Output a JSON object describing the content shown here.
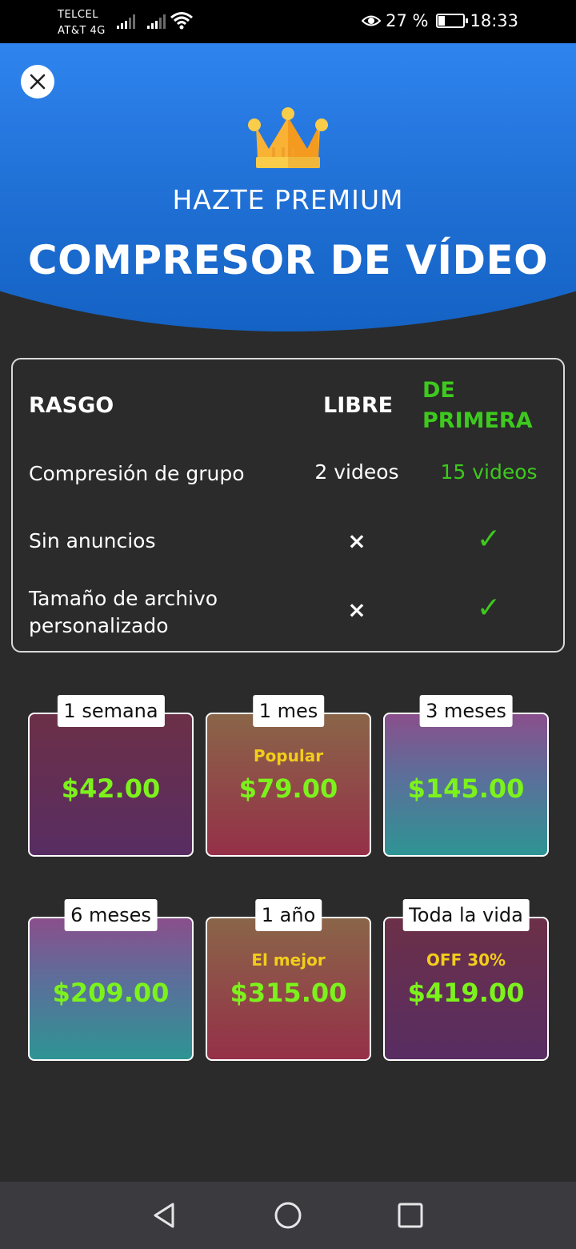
{
  "status_bar": {
    "carrier_1": "TELCEL",
    "carrier_2": "AT&T 4G",
    "battery_pct": "27 %",
    "time": "18:33",
    "icons": [
      "signal-icon",
      "signal-icon",
      "wifi-icon",
      "eye-icon",
      "battery-icon"
    ]
  },
  "header": {
    "close_icon": "close-icon",
    "crown_icon": "crown-icon",
    "subtitle": "HAZTE PREMIUM",
    "title": "COMPRESOR DE VÍDEO",
    "colors": {
      "top": "#2f84ee",
      "bottom": "#1462c4"
    }
  },
  "features": {
    "headers": {
      "feature": "RASGO",
      "free": "LIBRE",
      "premium": "DE PRIMERA"
    },
    "rows": [
      {
        "feature": "Compresión de grupo",
        "free": "2 videos",
        "premium": "15 videos"
      },
      {
        "feature": "Sin anuncios",
        "free": "×",
        "premium": "✓"
      },
      {
        "feature": "Tamaño de archivo personalizado",
        "free": "×",
        "premium": "✓"
      }
    ],
    "premium_color": "#3ec91e"
  },
  "plans": [
    {
      "label": "1 semana",
      "badge": "",
      "price": "$42.00"
    },
    {
      "label": "1 mes",
      "badge": "Popular",
      "price": "$79.00"
    },
    {
      "label": "3 meses",
      "badge": "",
      "price": "$145.00"
    },
    {
      "label": "6 meses",
      "badge": "",
      "price": "$209.00"
    },
    {
      "label": "1 año",
      "badge": "El mejor",
      "price": "$315.00"
    },
    {
      "label": "Toda la vida",
      "badge": "OFF 30%",
      "price": "$419.00"
    }
  ],
  "plan_colors": {
    "price": "#7cf21c",
    "badge": "#f2cd1b"
  },
  "nav_bar": {
    "icons": [
      "back-icon",
      "home-icon",
      "recents-icon"
    ]
  }
}
